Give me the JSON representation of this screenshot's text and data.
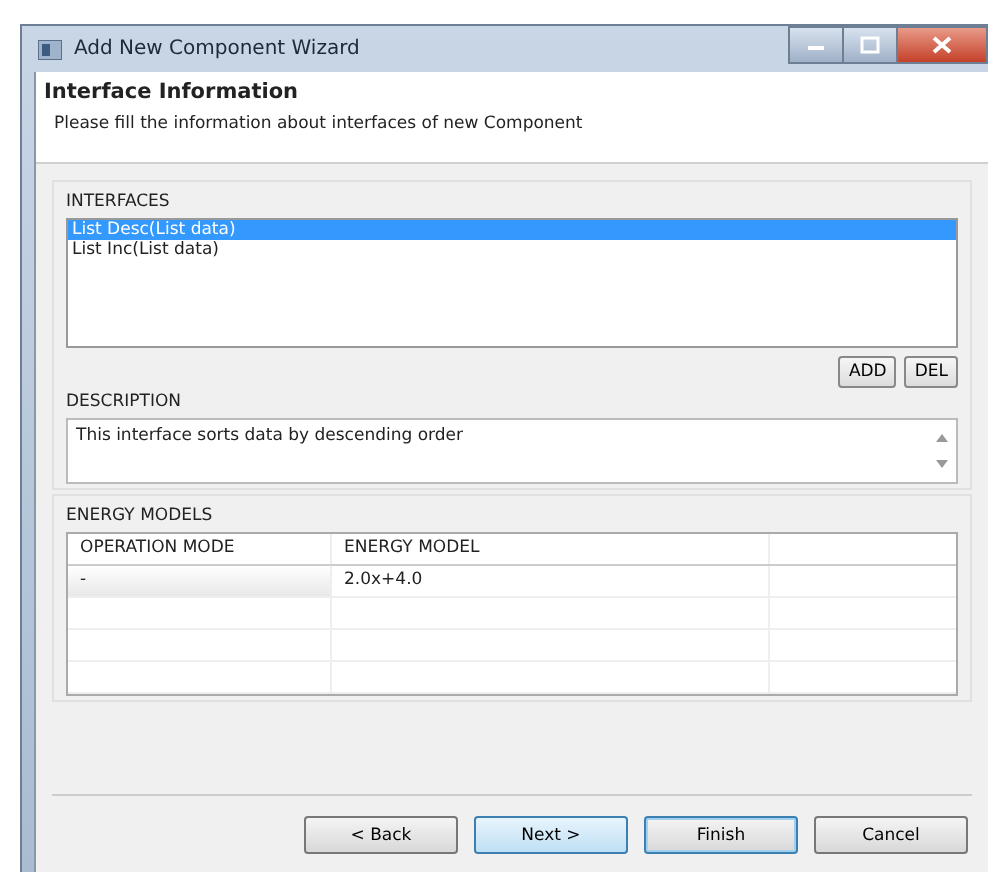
{
  "window": {
    "title": "Add New Component Wizard"
  },
  "header": {
    "title": "Interface Information",
    "subtitle": "Please fill the information about interfaces of new Component"
  },
  "interfaces": {
    "label": "INTERFACES",
    "items": [
      {
        "text": "List Desc(List data)",
        "selected": true
      },
      {
        "text": "List Inc(List data)",
        "selected": false
      }
    ],
    "buttons": [
      "ADD",
      "DEL"
    ]
  },
  "description": {
    "label": "DESCRIPTION",
    "value": "This interface sorts data by descending order"
  },
  "energy_models": {
    "label": "ENERGY MODELS",
    "columns": [
      "OPERATION MODE",
      "ENERGY MODEL"
    ],
    "rows": [
      [
        "-",
        "2.0x+4.0"
      ]
    ]
  },
  "buttons": [
    {
      "label": "< Back",
      "kind": "normal"
    },
    {
      "label": "Next >",
      "kind": "default"
    },
    {
      "label": "Finish",
      "kind": "focused"
    },
    {
      "label": "Cancel",
      "kind": "normal"
    }
  ]
}
